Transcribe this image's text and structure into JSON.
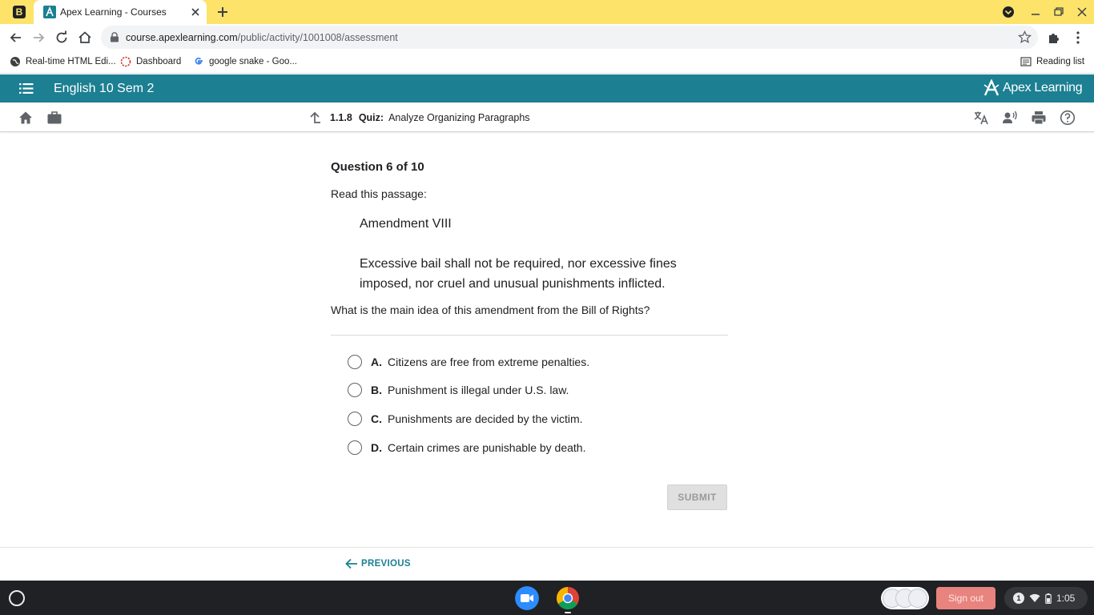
{
  "browser": {
    "tab_title": "Apex Learning - Courses",
    "app_badge": "B",
    "url_domain": "course.apexlearning.com",
    "url_path": "/public/activity/1001008/assessment",
    "bookmarks": [
      "Real-time HTML Edi...",
      "Dashboard",
      "google snake - Goo..."
    ],
    "reading_list": "Reading list"
  },
  "apex": {
    "course_title": "English 10 Sem 2",
    "brand": "Apex Learning",
    "activity_number": "1.1.8",
    "activity_type": "Quiz:",
    "activity_name": "Analyze Organizing Paragraphs"
  },
  "question": {
    "number_label": "Question 6 of 10",
    "lead": "Read this passage:",
    "passage_title": "Amendment VIII",
    "passage_body": "Excessive bail shall not be required, nor excessive fines imposed, nor cruel and unusual punishments inflicted.",
    "prompt": "What is the main idea of this amendment from the Bill of Rights?",
    "options": [
      {
        "letter": "A.",
        "text": "Citizens are free from extreme penalties."
      },
      {
        "letter": "B.",
        "text": "Punishment is illegal under U.S. law."
      },
      {
        "letter": "C.",
        "text": "Punishments are decided by the victim."
      },
      {
        "letter": "D.",
        "text": "Certain crimes are punishable by death."
      }
    ],
    "submit_label": "SUBMIT"
  },
  "footer": {
    "previous_label": "PREVIOUS"
  },
  "shelf": {
    "sign_out": "Sign out",
    "notifications": "1",
    "clock": "1:05"
  },
  "colors": {
    "tabstrip": "#fde36a",
    "apex_teal": "#1c7f92",
    "sign_out": "#e8837d",
    "shelf": "#202124"
  }
}
